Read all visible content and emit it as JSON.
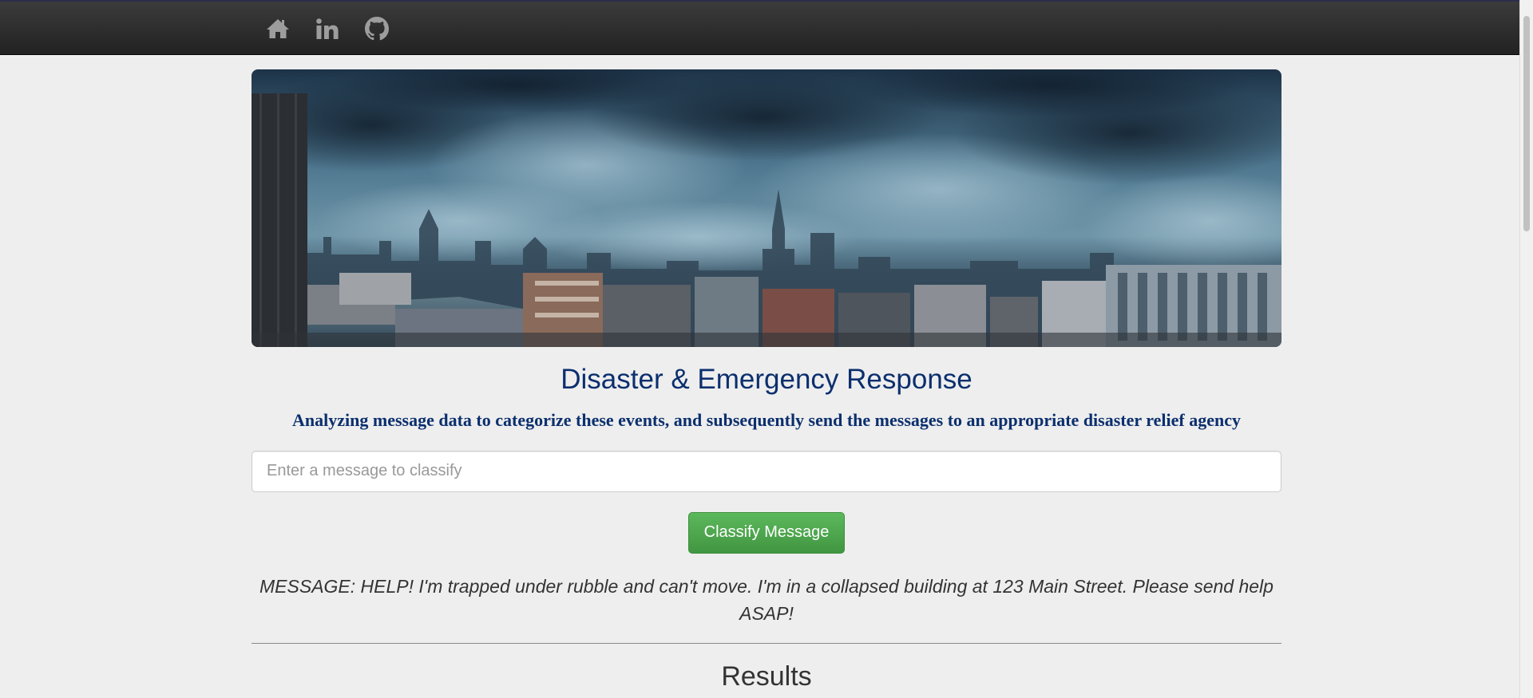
{
  "nav": {
    "icons": [
      "home-icon",
      "linkedin-icon",
      "github-icon"
    ]
  },
  "header": {
    "title": "Disaster & Emergency Response",
    "subtitle": "Analyzing message data to categorize these events, and subsequently send the messages to an appropriate disaster relief agency"
  },
  "form": {
    "placeholder": "Enter a message to classify",
    "button_label": "Classify Message"
  },
  "result": {
    "message": "MESSAGE: HELP! I'm trapped under rubble and can't move. I'm in a collapsed building at 123 Main Street. Please send help ASAP!",
    "results_heading": "Results"
  },
  "colors": {
    "title": "#0b2f6e",
    "button": "#5cb85c",
    "navbar": "#222222"
  }
}
